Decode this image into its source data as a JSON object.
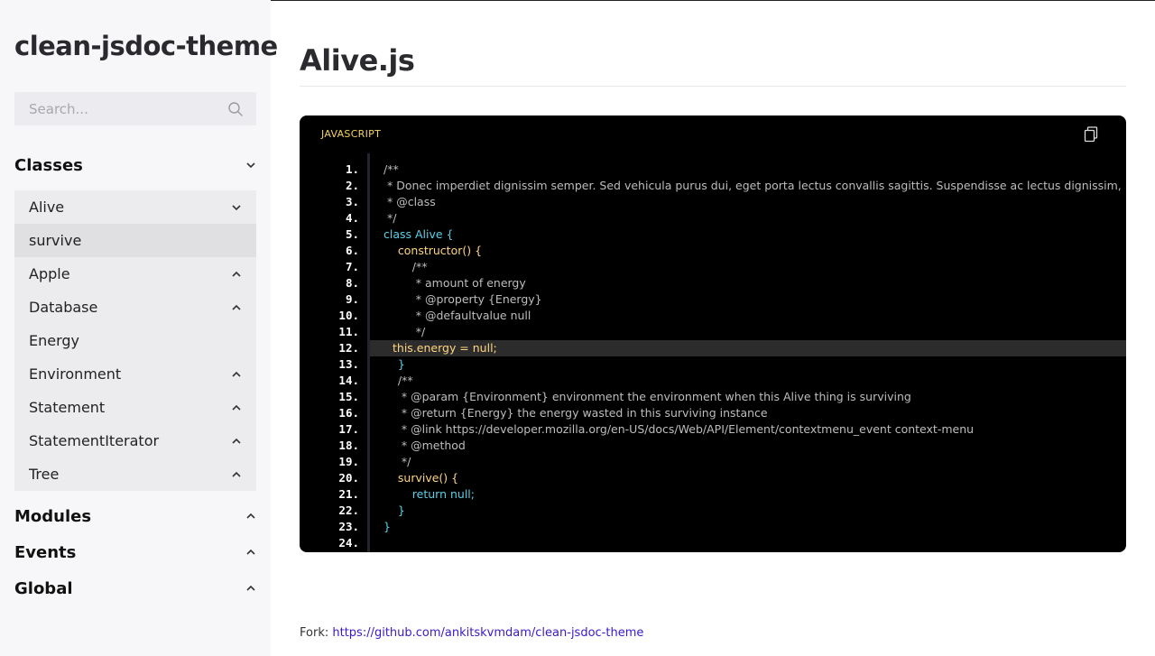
{
  "sidebar": {
    "brand": "clean-jsdoc-theme",
    "search_placeholder": "Search...",
    "sections": {
      "classes": "Classes",
      "modules": "Modules",
      "events": "Events",
      "global": "Global"
    },
    "classes": [
      {
        "label": "Alive",
        "chevron": "down"
      },
      {
        "label": "survive",
        "chevron": "none",
        "active": true
      },
      {
        "label": "Apple",
        "chevron": "up"
      },
      {
        "label": "Database",
        "chevron": "up"
      },
      {
        "label": "Energy",
        "chevron": "none"
      },
      {
        "label": "Environment",
        "chevron": "up"
      },
      {
        "label": "Statement",
        "chevron": "up"
      },
      {
        "label": "StatementIterator",
        "chevron": "up"
      },
      {
        "label": "Tree",
        "chevron": "up"
      }
    ]
  },
  "main": {
    "title": "Alive.js",
    "code": {
      "language": "JAVASCRIPT",
      "lines": [
        "1.",
        "2.",
        "3.",
        "4.",
        "5.",
        "6.",
        "7.",
        "8.",
        "9.",
        "10.",
        "11.",
        "12.",
        "13.",
        "14.",
        "15.",
        "16.",
        "17.",
        "18.",
        "19.",
        "20.",
        "21.",
        "22.",
        "23.",
        "24."
      ],
      "source": [
        "/**",
        " * Donec imperdiet dignissim semper. Sed vehicula purus dui, eget porta lectus convallis sagittis. Suspendisse ac lectus dignissim,",
        " * @class",
        " */",
        "class Alive {",
        "    constructor() {",
        "        /**",
        "         * amount of energy",
        "         * @property {Energy}",
        "         * @defaultvalue null",
        "         */",
        "this.energy = null;",
        "    }",
        "    /**",
        "     * @param {Environment} environment the environment when this Alive thing is surviving",
        "     * @return {Energy} the energy wasted in this surviving instance",
        "     * @link https://developer.mozilla.org/en-US/docs/Web/API/Element/contextmenu_event context-menu",
        "     * @method",
        "     */",
        "    survive() {",
        "        return null;",
        "    }",
        "}",
        ""
      ]
    },
    "footer": {
      "prefix": "Fork: ",
      "link": "https://github.com/ankitskvmdam/clean-jsdoc-theme"
    }
  },
  "colors": {
    "sidebar_bg": "#f7f7f9",
    "code_bg": "#000000",
    "lang_label": "#f4d35e",
    "keyword": "#5ccfe6",
    "class_name": "#ffd580",
    "link": "#3a19c7"
  },
  "icons": {
    "search": "search-icon",
    "copy": "copy-icon",
    "chevron_up": "chevron-up-icon",
    "chevron_down": "chevron-down-icon"
  }
}
